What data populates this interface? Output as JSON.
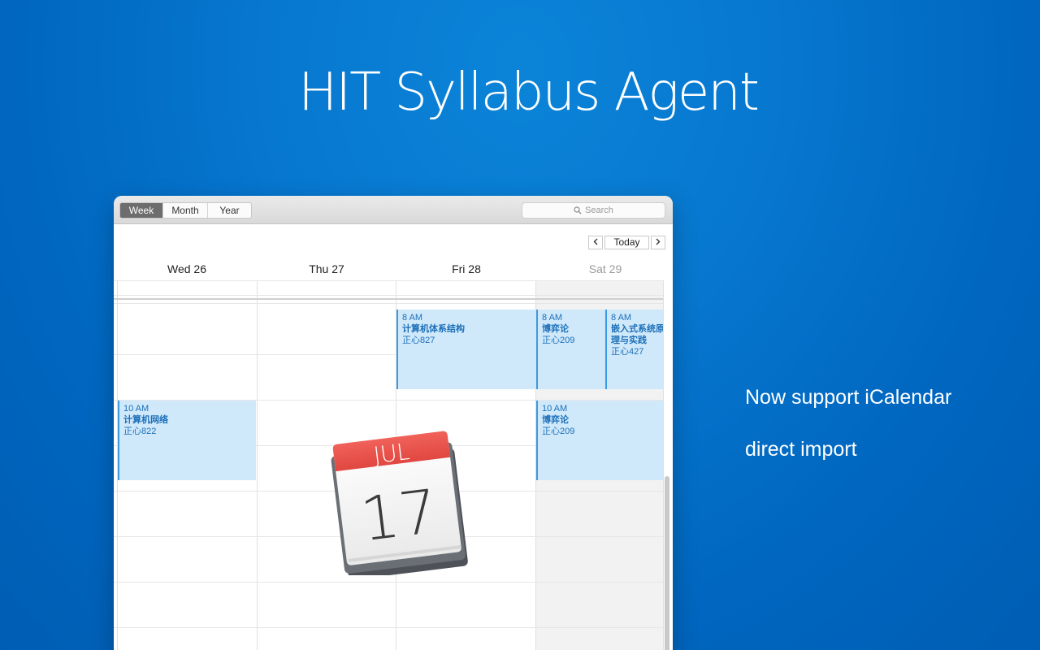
{
  "headline": "HIT Syllabus Agent",
  "tagline": {
    "line1": "Now support iCalendar",
    "line2": "direct import"
  },
  "window": {
    "view_tabs": {
      "week": "Week",
      "month": "Month",
      "year": "Year",
      "active": "Week"
    },
    "search": {
      "placeholder": "Search"
    },
    "nav": {
      "today": "Today"
    },
    "days": [
      "Wed 26",
      "Thu 27",
      "Fri 28",
      "Sat 29"
    ],
    "events": [
      {
        "time": "8 AM",
        "title": "计算机体系结构",
        "location": "正心827"
      },
      {
        "time": "8 AM",
        "title": "博弈论",
        "location": "正心209"
      },
      {
        "time": "8 AM",
        "title_line1": "嵌入式系统原",
        "title_line2": "理与实践",
        "location": "正心427"
      },
      {
        "time": "10 AM",
        "title": "计算机网络",
        "location": "正心822"
      },
      {
        "time": "10 AM",
        "title": "博弈论",
        "location": "正心209"
      }
    ]
  },
  "calendar_icon": {
    "month": "JUL",
    "day": "17"
  },
  "colors": {
    "background": "#0070c9",
    "event_fill": "#cfe9fb",
    "event_accent": "#3b9ae1",
    "event_text": "#1d6fb8",
    "icon_red": "#e8504a"
  }
}
